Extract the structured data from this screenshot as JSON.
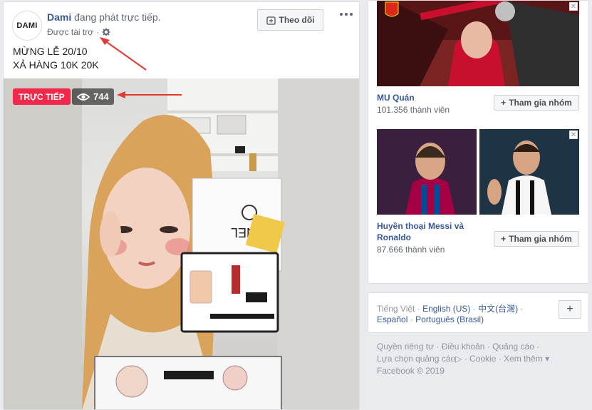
{
  "post": {
    "avatar_text": "DAMI",
    "page_name": "Dami",
    "head_action": " đang phát trực tiếp.",
    "sponsored": "Được tài trợ",
    "sponsored_dot": "·",
    "follow_label": "Theo dõi",
    "text_line1": "MỪNG LỄ 20/10",
    "text_line2": "XẢ HÀNG 10K 20K",
    "live_badge": "TRỰC TIẾP",
    "viewer_count": "744",
    "box_brand": "NEL"
  },
  "ads": [
    {
      "title": "MU Quán",
      "members": "101.356 thành viên",
      "join_label": "Tham gia nhóm"
    },
    {
      "title_line1": "Huyền thoại Messi và",
      "title_line2": "Ronaldo",
      "members": "87.666 thành viên",
      "join_label": "Tham gia nhóm"
    }
  ],
  "languages": {
    "current": "Tiếng Việt",
    "sep": "·",
    "options": [
      "English (US)",
      "中文(台灣)",
      "Español",
      "Português (Brasil)"
    ],
    "add_label": "+"
  },
  "footer": {
    "links": [
      "Quyền riêng tư",
      "Điều khoản",
      "Quảng cáo",
      "Lựa chọn quảng cáo",
      "Cookie",
      "Xem thêm"
    ],
    "sep": "·",
    "adchoices_glyph": "▷",
    "more_caret": "▾",
    "copyright": "Facebook © 2019"
  },
  "colors": {
    "link_blue": "#385898",
    "live_red": "#f02849",
    "annotation_red": "#e53935",
    "page_bg": "#e9ebee"
  }
}
